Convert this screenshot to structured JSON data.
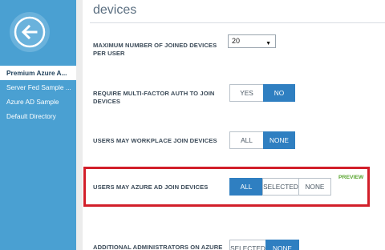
{
  "sidebar": {
    "nav_items": [
      {
        "label": "Premium Azure A..."
      },
      {
        "label": "Server Fed Sample ..."
      },
      {
        "label": "Azure AD Sample"
      },
      {
        "label": "Default Directory"
      }
    ]
  },
  "main": {
    "title": "devices",
    "settings": [
      {
        "label_line1": "MAXIMUM NUMBER OF JOINED DEVICES",
        "label_line2": "PER USER",
        "select_value": "20"
      },
      {
        "label_line1": "REQUIRE MULTI-FACTOR AUTH TO JOIN",
        "label_line2": "DEVICES",
        "options": [
          "YES",
          "NO"
        ],
        "selected": "NO"
      },
      {
        "label": "USERS MAY WORKPLACE JOIN DEVICES",
        "options": [
          "ALL",
          "NONE"
        ],
        "selected": "NONE"
      },
      {
        "label": "USERS MAY AZURE AD JOIN DEVICES",
        "options": [
          "ALL",
          "SELECTED",
          "NONE"
        ],
        "selected": "ALL",
        "badge": "PREVIEW"
      },
      {
        "label": "ADDITIONAL ADMINISTRATORS ON AZURE",
        "options": [
          "SELECTED",
          "NONE"
        ],
        "selected": "NONE"
      }
    ]
  },
  "colors": {
    "sidebar": "#4aa0d2",
    "toggle_selected": "#2f7fc1",
    "highlight_box": "#d21f2a",
    "preview_badge": "#58a52e"
  },
  "icons": {
    "back": "back-arrow-icon"
  }
}
